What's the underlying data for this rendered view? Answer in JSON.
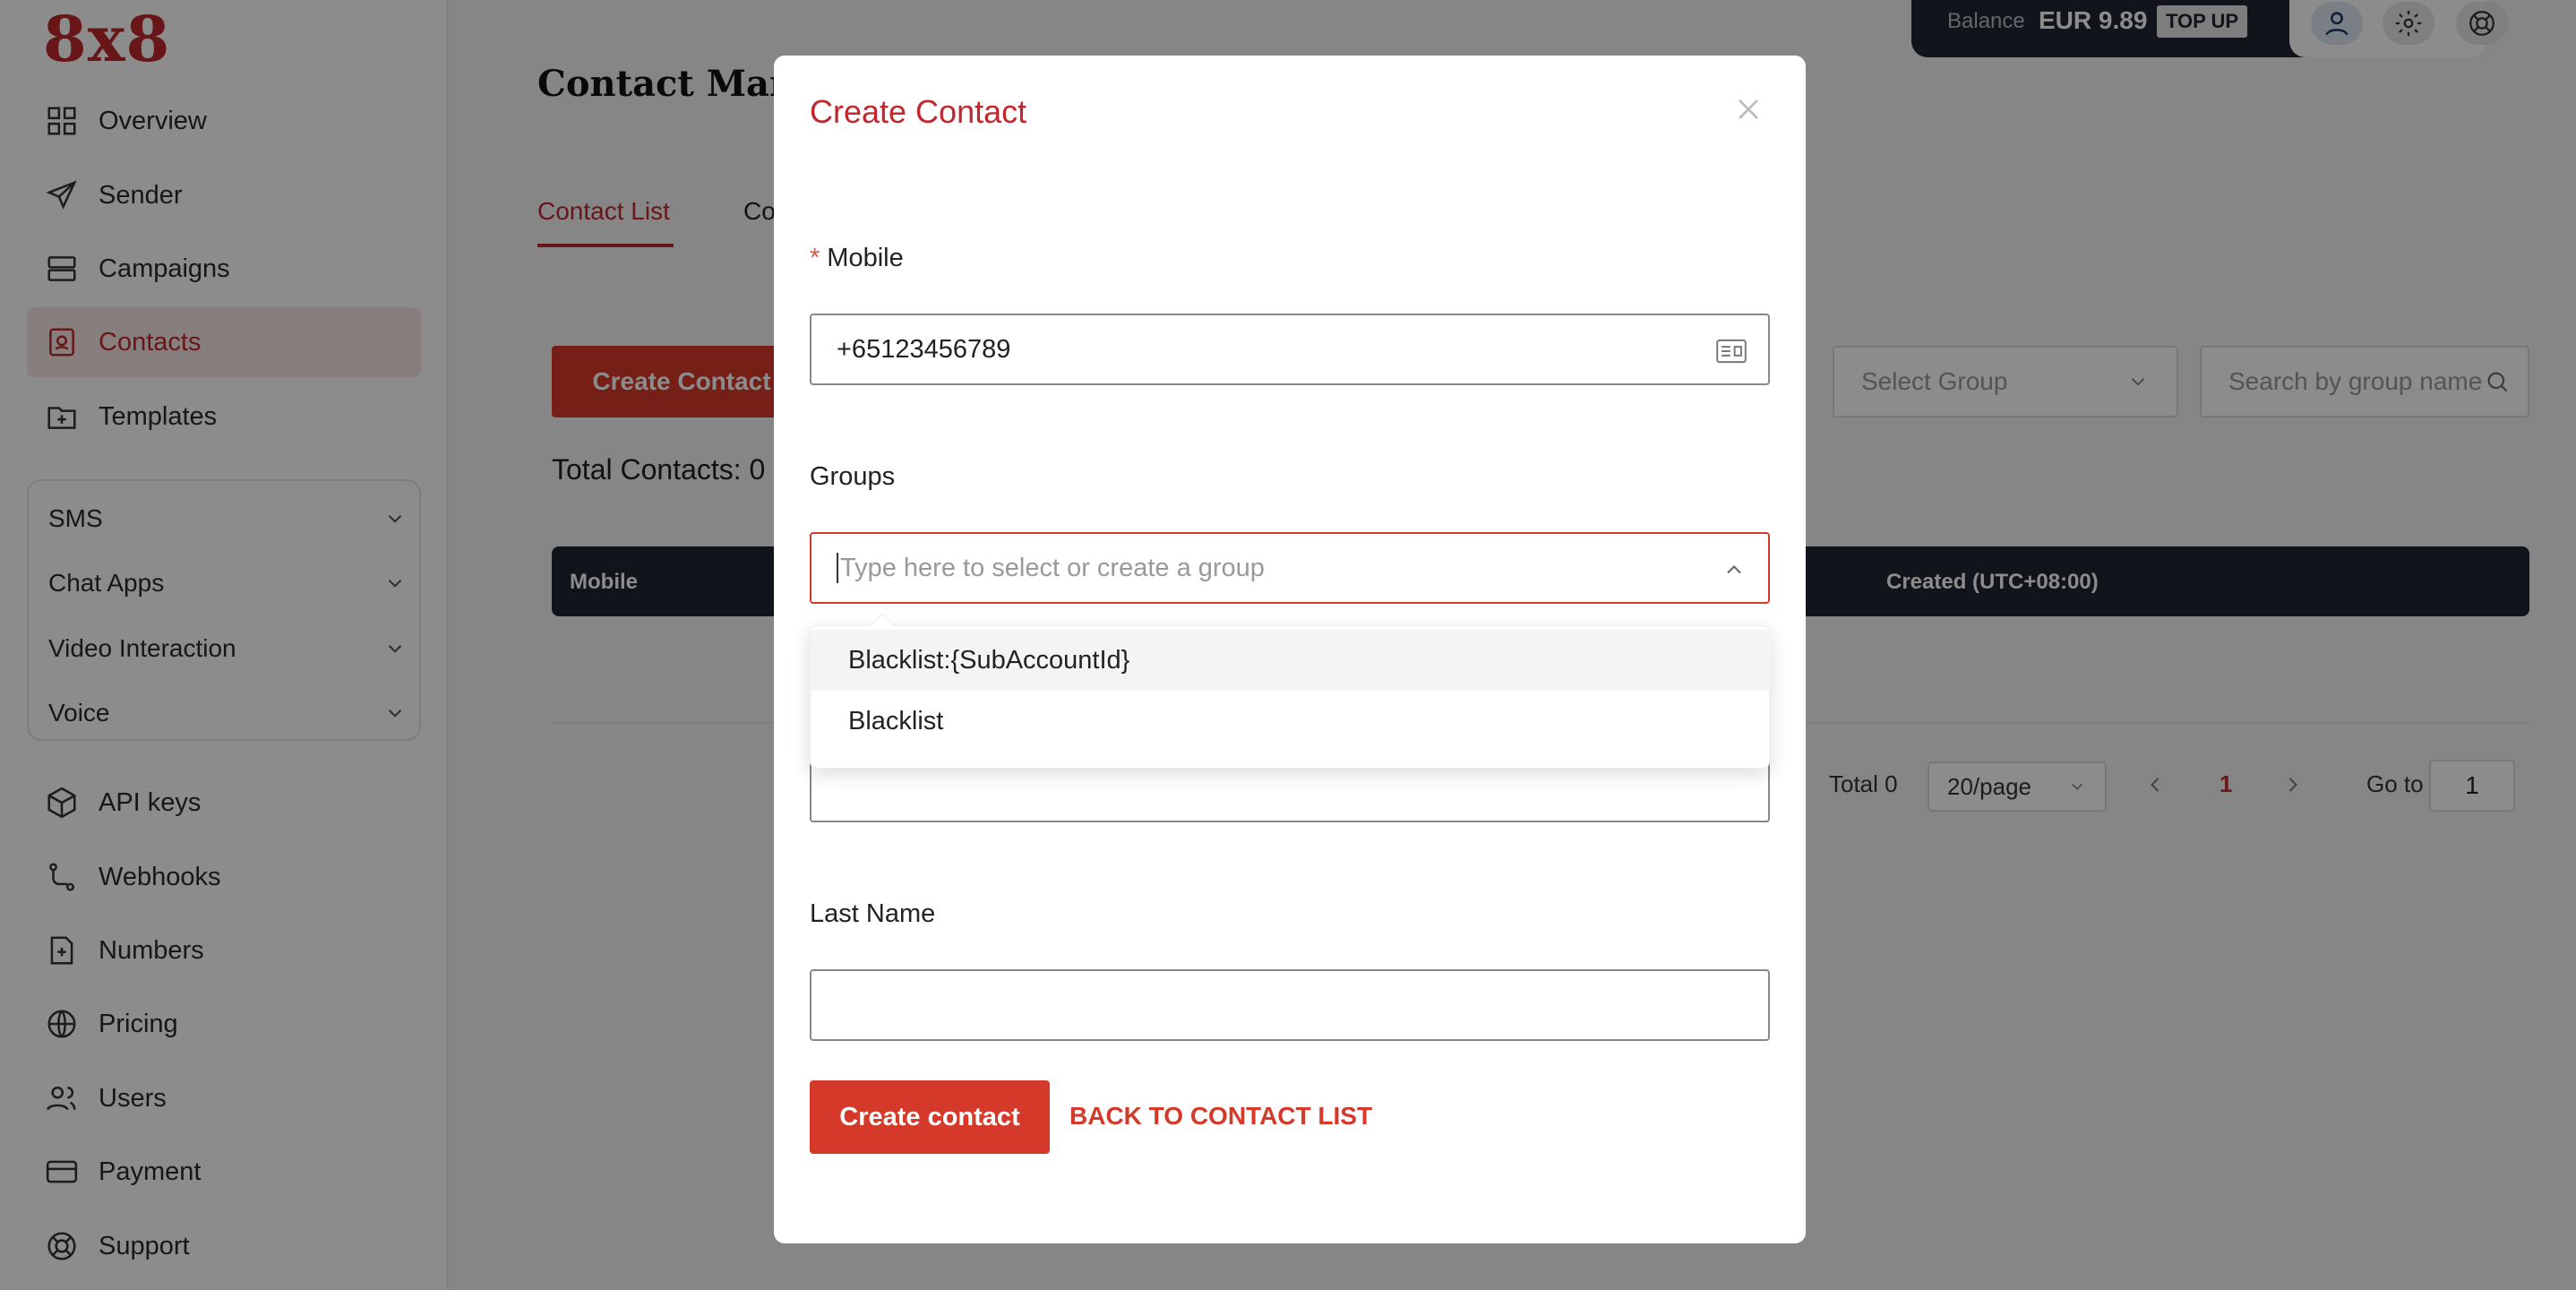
{
  "app": {
    "logo": "8x8"
  },
  "sidebar": {
    "top_items": [
      {
        "label": "Overview",
        "icon": "grid-icon"
      },
      {
        "label": "Sender",
        "icon": "send-icon"
      },
      {
        "label": "Campaigns",
        "icon": "campaigns-icon"
      },
      {
        "label": "Contacts",
        "icon": "contacts-icon",
        "active": true
      },
      {
        "label": "Templates",
        "icon": "templates-icon"
      }
    ],
    "groups": [
      {
        "label": "SMS"
      },
      {
        "label": "Chat Apps"
      },
      {
        "label": "Video Interaction"
      },
      {
        "label": "Voice"
      }
    ],
    "bottom_items": [
      {
        "label": "API keys",
        "icon": "cube-icon"
      },
      {
        "label": "Webhooks",
        "icon": "webhook-icon"
      },
      {
        "label": "Numbers",
        "icon": "numbers-icon"
      },
      {
        "label": "Pricing",
        "icon": "globe-icon"
      },
      {
        "label": "Users",
        "icon": "users-icon"
      },
      {
        "label": "Payment",
        "icon": "card-icon"
      },
      {
        "label": "Support",
        "icon": "lifebuoy-icon"
      }
    ]
  },
  "header": {
    "balance_label": "Balance",
    "balance_value": "EUR 9.89",
    "topup_label": "TOP UP"
  },
  "main": {
    "title": "Contact Mana",
    "tabs": [
      {
        "label": "Contact List"
      },
      {
        "label": "Co"
      }
    ],
    "create_button": "Create Contact",
    "total_contacts": "Total Contacts: 0",
    "select_group_placeholder": "Select Group",
    "search_placeholder": "Search by group name",
    "table_headers": [
      "Mobile",
      "Created (UTC+08:00)"
    ],
    "pagination": {
      "total": "Total 0",
      "page_size": "20/page",
      "current_page": "1",
      "goto_label": "Go to",
      "goto_value": "1"
    }
  },
  "modal": {
    "title": "Create Contact",
    "mobile_label": "Mobile",
    "mobile_required_mark": "*",
    "mobile_value": "+65123456789",
    "groups_label": "Groups",
    "groups_placeholder": "Type here to select or create a group",
    "group_options": [
      "Blacklist:{SubAccountId}",
      "Blacklist"
    ],
    "last_name_label": "Last Name",
    "last_name_value": "",
    "submit_label": "Create contact",
    "back_label": "BACK TO CONTACT LIST"
  },
  "colors": {
    "accent": "#d5392a",
    "brand": "#c0282d",
    "dark": "#1f2530"
  }
}
